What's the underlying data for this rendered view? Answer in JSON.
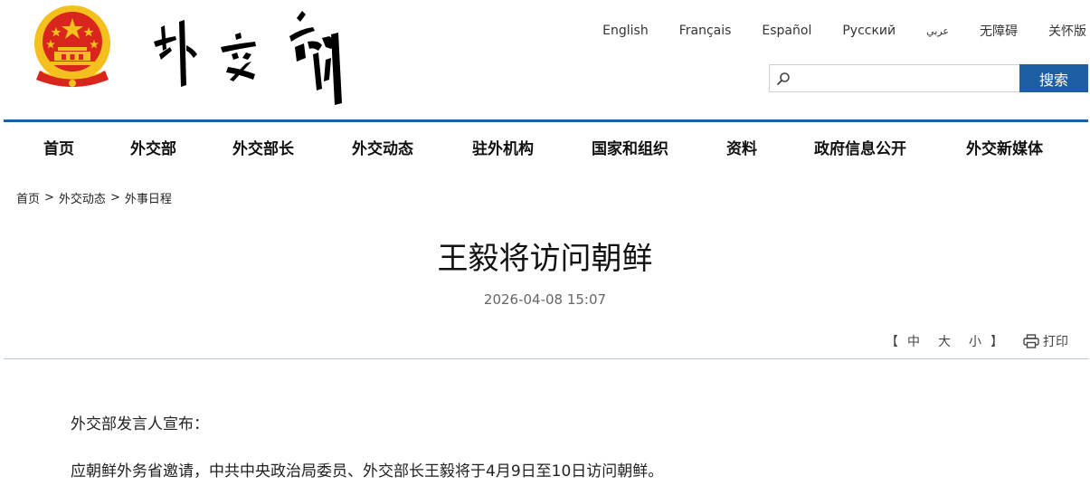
{
  "header": {
    "emblem_icon": "national-emblem-icon",
    "calligraphy_logo": "外交部",
    "languages": [
      "English",
      "Français",
      "Español",
      "Русский",
      "عربي",
      "无障碍",
      "关怀版"
    ]
  },
  "search": {
    "placeholder": "",
    "value": "",
    "button_label": "搜索",
    "icon": "search-icon"
  },
  "nav": {
    "items": [
      "首页",
      "外交部",
      "外交部长",
      "外交动态",
      "驻外机构",
      "国家和组织",
      "资料",
      "政府信息公开",
      "外交新媒体"
    ]
  },
  "breadcrumb": {
    "items": [
      "首页",
      "外交动态",
      "外事日程"
    ],
    "separator": ">"
  },
  "article": {
    "title": "王毅将访问朝鲜",
    "date": "2026-04-08 15:07",
    "paragraphs": [
      "外交部发言人宣布：",
      "应朝鲜外务省邀请，中共中央政治局委员、外交部长王毅将于4月9日至10日访问朝鲜。"
    ]
  },
  "toolbar": {
    "open_bracket": "【",
    "close_bracket": "】",
    "font_sizes": [
      "中",
      "大",
      "小"
    ],
    "print_label": "打印",
    "print_icon": "printer-icon"
  },
  "colors": {
    "brand_blue": "#1d5fa5",
    "emblem_red": "#d8261c",
    "emblem_gold": "#f4c01e",
    "divider": "#b8cde0"
  }
}
